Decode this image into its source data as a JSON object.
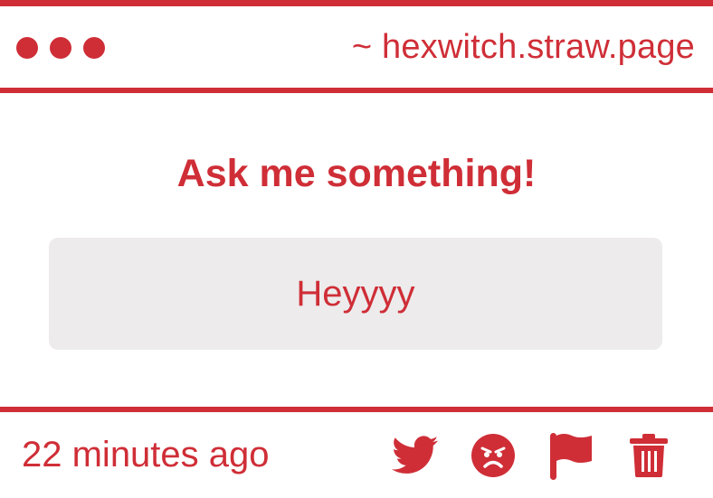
{
  "header": {
    "site_url": "~ hexwitch.straw.page"
  },
  "main": {
    "title": "Ask me something!",
    "message": "Heyyyy"
  },
  "footer": {
    "timestamp": "22 minutes ago",
    "actions": [
      "twitter-icon",
      "angry-face-icon",
      "flag-icon",
      "trash-icon"
    ]
  },
  "colors": {
    "accent": "#cf2e37",
    "message_background": "#edebec",
    "background": "#ffffff"
  }
}
